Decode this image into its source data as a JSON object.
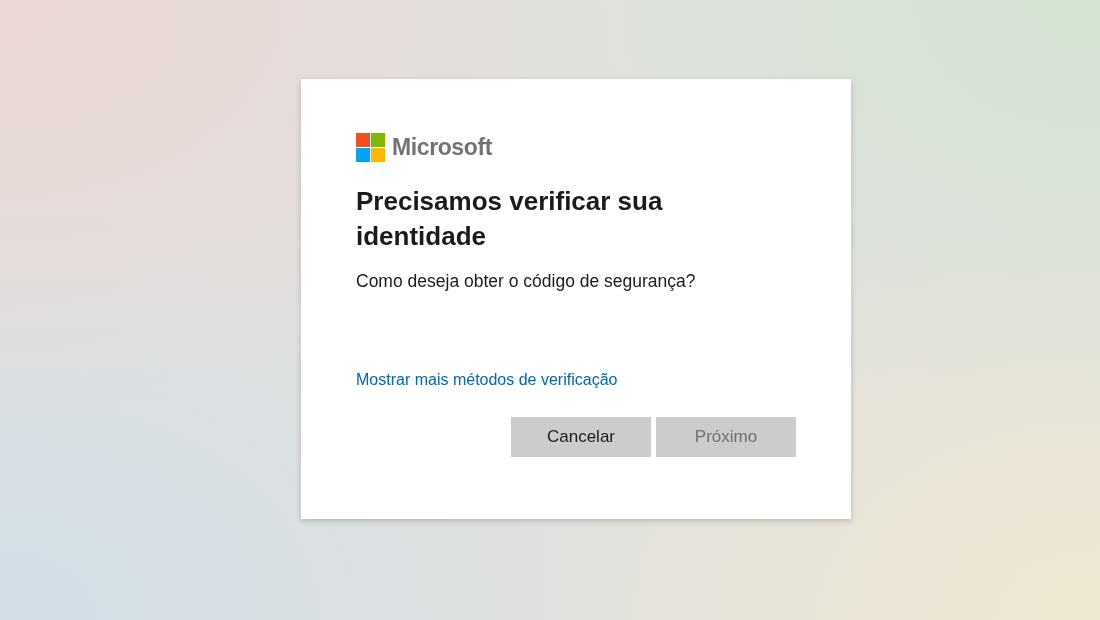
{
  "logo": {
    "wordmark": "Microsoft"
  },
  "title": "Precisamos verificar sua identidade",
  "prompt": "Como deseja obter o código de segurança?",
  "link": "Mostrar mais métodos de verificação",
  "buttons": [
    {
      "label": "Cancelar",
      "disabled": false
    },
    {
      "label": "Próximo",
      "disabled": true
    }
  ]
}
